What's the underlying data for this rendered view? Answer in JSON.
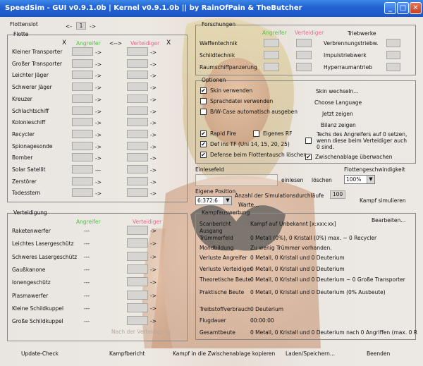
{
  "title": "SpeedSim - GUI v0.9.1.0b  |  Kernel v0.9.1.0b  ||  by RainOfPain & TheButcher",
  "fleet_slot": {
    "label": "Flottenslot",
    "prev": "<-",
    "value": "1",
    "next": "->"
  },
  "fleet": {
    "title": "Flotte",
    "clear_left": "X",
    "swap": "<-->",
    "clear_right": "X",
    "attacker_label": "Angreifer",
    "defender_label": "Verteidiger",
    "rows": [
      {
        "name": "Kleiner Transporter",
        "mid": "->"
      },
      {
        "name": "Großer Transporter",
        "mid": "->"
      },
      {
        "name": "Leichter Jäger",
        "mid": "->"
      },
      {
        "name": "Schwerer Jäger",
        "mid": "->"
      },
      {
        "name": "Kreuzer",
        "mid": "->"
      },
      {
        "name": "Schlachtschiff",
        "mid": "->"
      },
      {
        "name": "Kolonieschiff",
        "mid": "->"
      },
      {
        "name": "Recycler",
        "mid": "->"
      },
      {
        "name": "Spionagesonde",
        "mid": "->"
      },
      {
        "name": "Bomber",
        "mid": "->"
      },
      {
        "name": "Solar Satellit",
        "mid": "---"
      },
      {
        "name": "Zerstörer",
        "mid": "->"
      },
      {
        "name": "Todesstern",
        "mid": "->"
      }
    ]
  },
  "defense": {
    "title": "Verteidigung",
    "attacker_label": "Angreifer",
    "defender_label": "Verteidiger",
    "rows": [
      {
        "name": "Raketenwerfer",
        "mid": "---"
      },
      {
        "name": "Leichtes Lasergeschütz",
        "mid": "---"
      },
      {
        "name": "Schweres Lasergeschütz",
        "mid": "---"
      },
      {
        "name": "Gaußkanone",
        "mid": "---"
      },
      {
        "name": "Ionengeschütz",
        "mid": "---"
      },
      {
        "name": "Plasmawerfer",
        "mid": "---"
      },
      {
        "name": "Kleine Schildkuppel",
        "mid": "---"
      },
      {
        "name": "Große Schildkuppel",
        "mid": "---"
      }
    ],
    "repair_hint": "Nach der Verteidigung"
  },
  "research": {
    "title": "Forschungen",
    "attacker_label": "Angreifer",
    "defender_label": "Verteidiger",
    "left_rows": [
      "Waffentechnik",
      "Schildtechnik",
      "Raumschiffpanzerung"
    ],
    "drives_title": "Triebwerke",
    "drive_rows": [
      "Verbrennungstriebw.",
      "Impulstriebwerk",
      "Hyperraumantrieb"
    ]
  },
  "options": {
    "title": "Optionen",
    "items": [
      {
        "label": "Skin verwenden",
        "checked": "✔"
      },
      {
        "label": "Sprachdatei verwenden",
        "checked": ""
      },
      {
        "label": "B/W-Case automatisch ausgeben",
        "checked": ""
      },
      {
        "label": "Rapid Fire",
        "checked": "✔"
      },
      {
        "label": "Eigenes RF",
        "checked": ""
      },
      {
        "label": "Def ins TF (Uni 14, 15, 20, 25)",
        "checked": "✔"
      },
      {
        "label": "Defense beim Flottentausch löschen",
        "checked": "✔"
      }
    ],
    "links": [
      "Skin wechseln...",
      "Choose Language",
      "Jetzt zeigen",
      "Bilanz zeigen"
    ],
    "techs_note": "Techs des Angreifers auf 0 setzen, wenn diese beim Verteidiger auch 0 sind.",
    "techs_checked": "",
    "clipboard_label": "Zwischenablage überwachen",
    "clipboard_checked": "✔"
  },
  "import": {
    "title": "Einlesefeld",
    "read_button": "einlesen",
    "clear_button": "löschen",
    "speed_label": "Flottengeschwindigkeit",
    "speed_value": "100%",
    "position_label": "Eigene Position",
    "position_value": "6:372:6",
    "runs_label": "Anzahl der Simulationsdurchläufe",
    "runs_value": "100",
    "wait_label": "Warte...",
    "simulate_button": "Kampf simulieren"
  },
  "result": {
    "title": "Kampfauswertung",
    "edit_button": "Bearbeiten...",
    "rows": [
      {
        "label": "Scanbericht Ausgang",
        "value": "Kampf auf Unbekannt [x:xxx:xx]"
      },
      {
        "label": "Trümmerfeld",
        "value": "0 Metall (0%), 0 Kristall (0%) max. ~ 0 Recycler"
      },
      {
        "label": "Mondbildung",
        "value": "Zu wenig Trümmer vorhanden."
      },
      {
        "label": "Verluste Angreifer",
        "value": "0 Metall, 0 Kristall und 0 Deuterium"
      },
      {
        "label": "Verluste Verteidiger",
        "value": "0 Metall, 0 Kristall und 0 Deuterium"
      },
      {
        "label": "Theoretische Beute",
        "value": "0 Metall, 0 Kristall und 0 Deuterium ~ 0 Große Transporter"
      },
      {
        "label": "Praktische Beute",
        "value": "0 Metall, 0 Kristall und 0 Deuterium (0% Ausbeute)"
      },
      {
        "label": "Treibstoffverbrauch",
        "value": "0 Deuterium"
      },
      {
        "label": "Flugdauer",
        "value": "00:00:00"
      },
      {
        "label": "Gesamtbeute",
        "value": "0 Metall, 0 Kristall und 0 Deuterium nach 0 Angriffen (max. 0 R"
      }
    ]
  },
  "bottom_bar": [
    "Update-Check",
    "Kampfbericht",
    "Kampf in die Zwischenablage kopieren",
    "Laden/Speichern...",
    "Beenden"
  ]
}
